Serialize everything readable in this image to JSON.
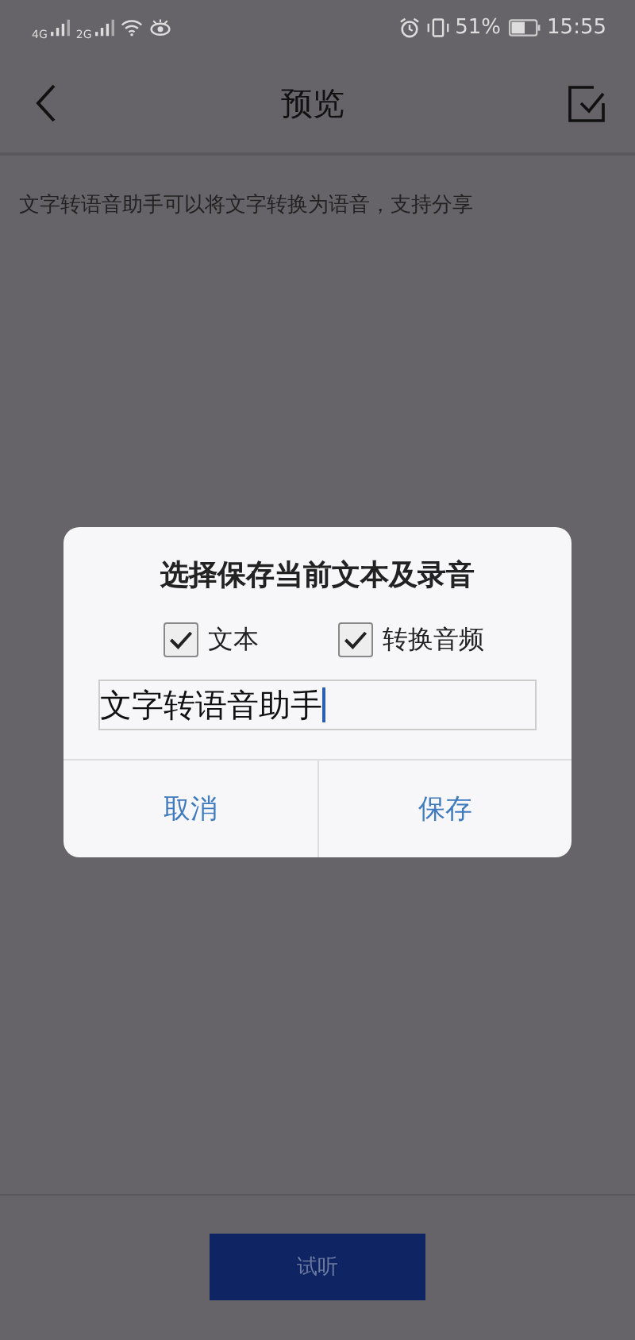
{
  "status_bar": {
    "networks": [
      "4G",
      "2G"
    ],
    "battery": "51%",
    "time": "15:55"
  },
  "header": {
    "title": "预览"
  },
  "content": {
    "text": "文字转语音助手可以将文字转换为语音，支持分享"
  },
  "dialog": {
    "title": "选择保存当前文本及录音",
    "options": [
      {
        "label": "文本",
        "checked": true
      },
      {
        "label": "转换音频",
        "checked": true
      }
    ],
    "name_field": {
      "value": "文字转语音助手"
    },
    "buttons": [
      "取消",
      "保存"
    ]
  },
  "footer": {
    "button": "试听"
  }
}
